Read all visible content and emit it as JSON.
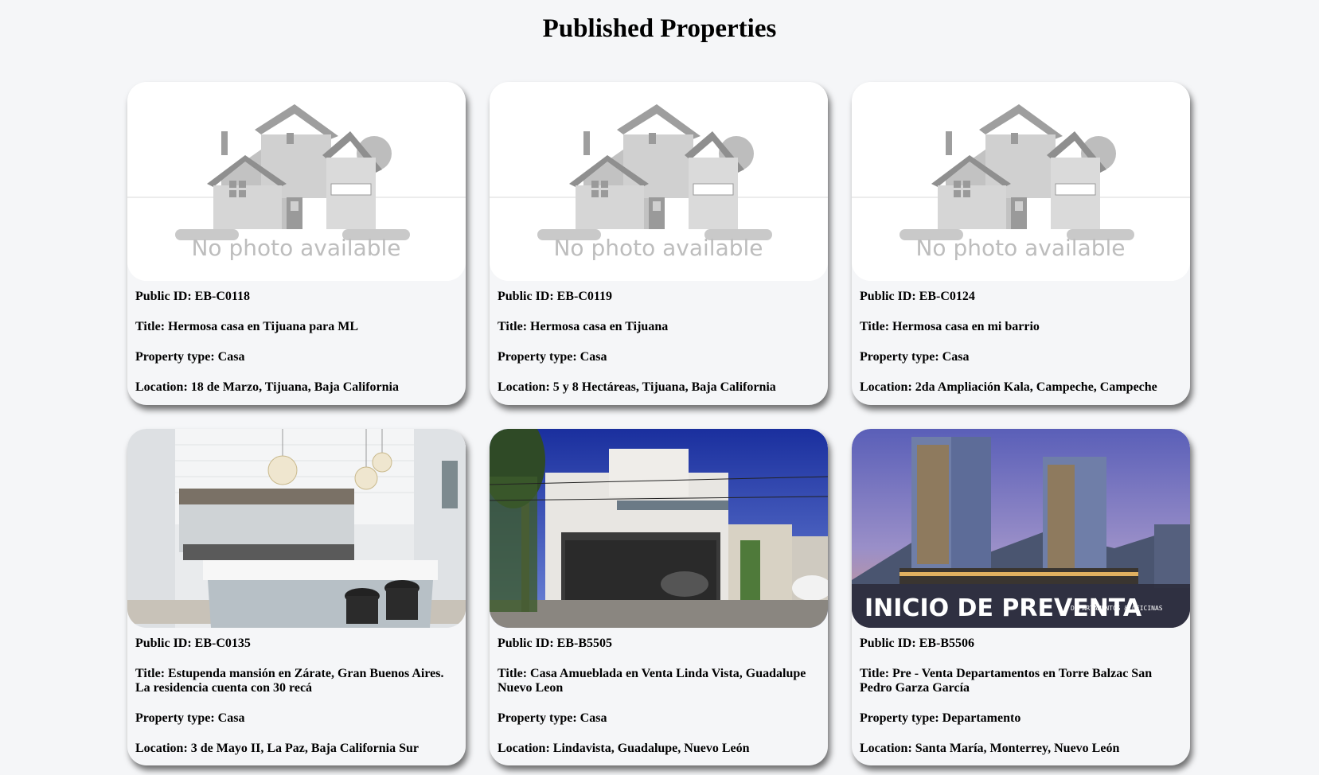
{
  "page": {
    "title": "Published Properties"
  },
  "labels": {
    "public_id": "Public ID: ",
    "title": "Title: ",
    "property_type": "Property type: ",
    "location": "Location: "
  },
  "placeholder_text": "No photo available",
  "properties": [
    {
      "public_id": "EB-C0118",
      "title": "Hermosa casa en Tijuana para ML",
      "property_type": "Casa",
      "location": "18 de Marzo, Tijuana, Baja California",
      "image": "no-photo-placeholder"
    },
    {
      "public_id": "EB-C0119",
      "title": "Hermosa casa en Tijuana",
      "property_type": "Casa",
      "location": "5 y 8 Hectáreas, Tijuana, Baja California",
      "image": "no-photo-placeholder"
    },
    {
      "public_id": "EB-C0124",
      "title": "Hermosa casa en mi barrio",
      "property_type": "Casa",
      "location": "2da Ampliación Kala, Campeche, Campeche",
      "image": "no-photo-placeholder"
    },
    {
      "public_id": "EB-C0135",
      "title": "Estupenda mansión en Zárate, Gran Buenos Aires. La residencia cuenta con 30 recá",
      "property_type": "Casa",
      "location": "3 de Mayo II, La Paz, Baja California Sur",
      "image": "kitchen-photo"
    },
    {
      "public_id": "EB-B5505",
      "title": "Casa Amueblada en Venta Linda Vista, Guadalupe Nuevo Leon",
      "property_type": "Casa",
      "location": "Lindavista, Guadalupe, Nuevo León",
      "image": "house-street-photo"
    },
    {
      "public_id": "EB-B5506",
      "title": "Pre - Venta Departamentos en Torre Balzac San Pedro Garza García",
      "property_type": "Departamento",
      "location": "Santa María, Monterrey, Nuevo León",
      "image": "towers-photo",
      "image_text": "INICIO DE PREVENTA",
      "image_subtext": "DEPARTAMENTOS & OFICINAS"
    }
  ]
}
